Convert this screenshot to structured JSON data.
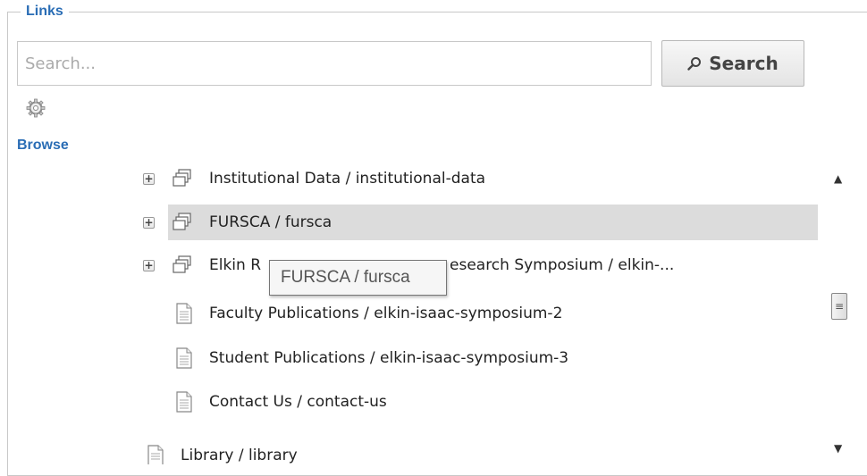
{
  "links": {
    "legend": "Links",
    "search_placeholder": "Search...",
    "search_button": "Search",
    "settings_icon": "gear-icon",
    "browse_label": "Browse"
  },
  "tree": {
    "items": [
      {
        "label": "Institutional Data / institutional-data",
        "icon": "folder-stack-icon",
        "expandable": true
      },
      {
        "label": "FURSCA / fursca",
        "icon": "folder-stack-icon",
        "expandable": true,
        "highlighted": true
      },
      {
        "label": "Elkin R",
        "label_tail": "esearch Symposium / elkin-...",
        "icon": "folder-stack-icon",
        "expandable": true
      },
      {
        "label": "Faculty Publications / elkin-isaac-symposium-2",
        "icon": "page-icon",
        "expandable": false
      },
      {
        "label": "Student Publications / elkin-isaac-symposium-3",
        "icon": "page-icon",
        "expandable": false
      },
      {
        "label": "Contact Us / contact-us",
        "icon": "page-icon",
        "expandable": false
      },
      {
        "label": "Library / library",
        "icon": "page-icon",
        "expandable": false
      }
    ]
  },
  "tooltip": {
    "text": "FURSCA / fursca"
  },
  "colors": {
    "accent": "#2a6db5",
    "highlight": "#dcdcdc"
  }
}
